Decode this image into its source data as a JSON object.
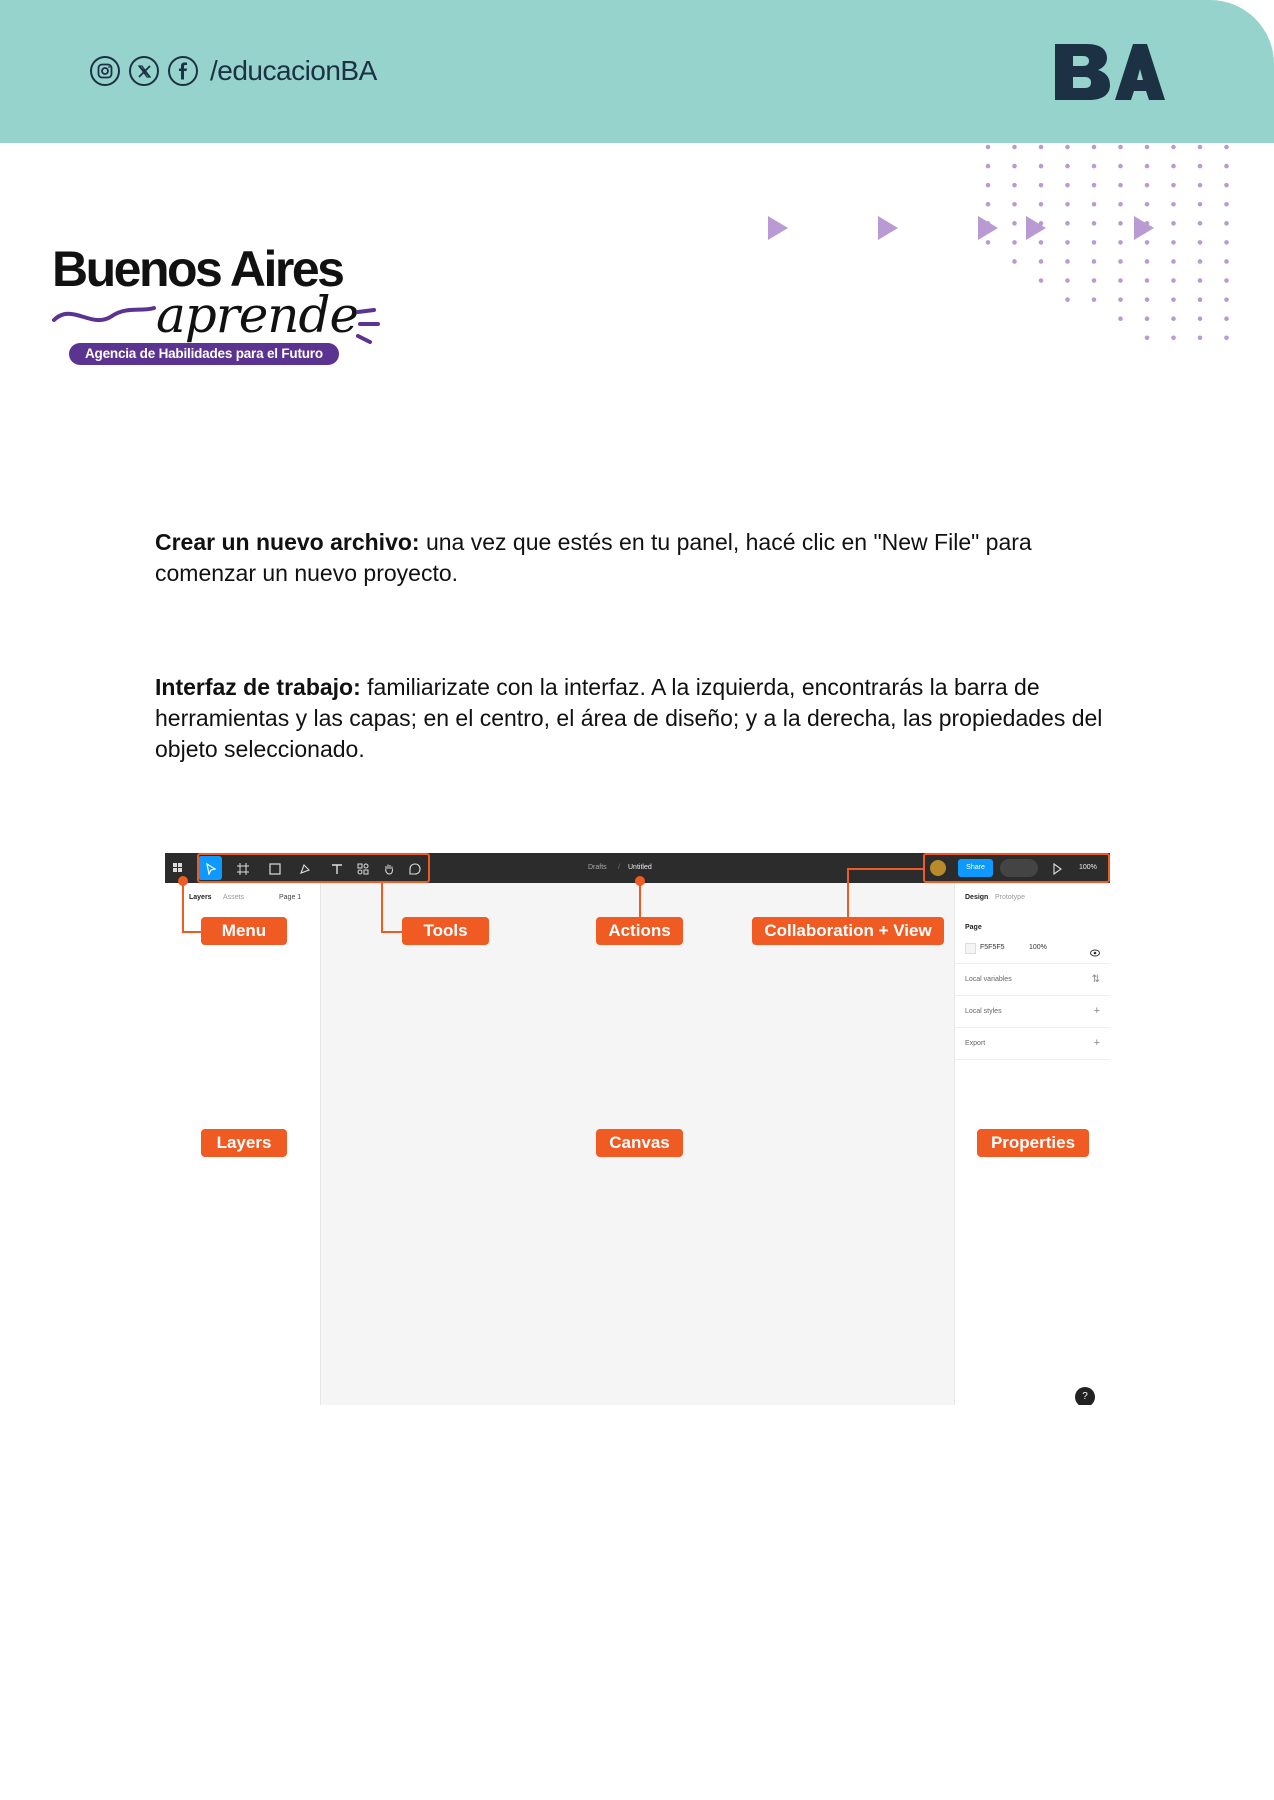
{
  "header": {
    "social_handle": "/educacionBA",
    "social_icons": [
      "instagram-icon",
      "x-icon",
      "facebook-icon"
    ],
    "logo_text": "BA",
    "background_color": "#96d3cd",
    "ink_color": "#1c3143"
  },
  "brand": {
    "title": "Buenos Aires",
    "script": "aprende",
    "tagline": "Agencia de Habilidades para el Futuro",
    "accent_color": "#5b3390"
  },
  "paragraphs": [
    {
      "lead": "Crear un nuevo archivo:",
      "text": " una vez que estés en tu panel, hacé clic en \"New File\" para comenzar un nuevo proyecto."
    },
    {
      "lead": "Interfaz de trabajo:",
      "text": " familiarizate con la interfaz. A la izquierda, encontrarás la barra de herramientas y las capas; en el centro, el área de diseño; y a la derecha, las propiedades del objeto seleccionado."
    }
  ],
  "figure": {
    "breadcrumb_parent": "Drafts",
    "breadcrumb_sep": "/",
    "file_name": "Untitled",
    "share_label": "Share",
    "zoom": "100%",
    "left_tabs": [
      "Layers",
      "Assets"
    ],
    "page_selector": "Page 1",
    "right_tabs": [
      "Design",
      "Prototype"
    ],
    "page_section": "Page",
    "page_color": "F5F5F5",
    "page_opacity": "100%",
    "local_variables": "Local variables",
    "local_styles": "Local styles",
    "export": "Export",
    "help": "?",
    "callouts": {
      "menu": "Menu",
      "tools": "Tools",
      "actions": "Actions",
      "collab": "Collaboration + View",
      "layers": "Layers",
      "canvas": "Canvas",
      "properties": "Properties"
    },
    "accent_color": "#f05a23"
  }
}
